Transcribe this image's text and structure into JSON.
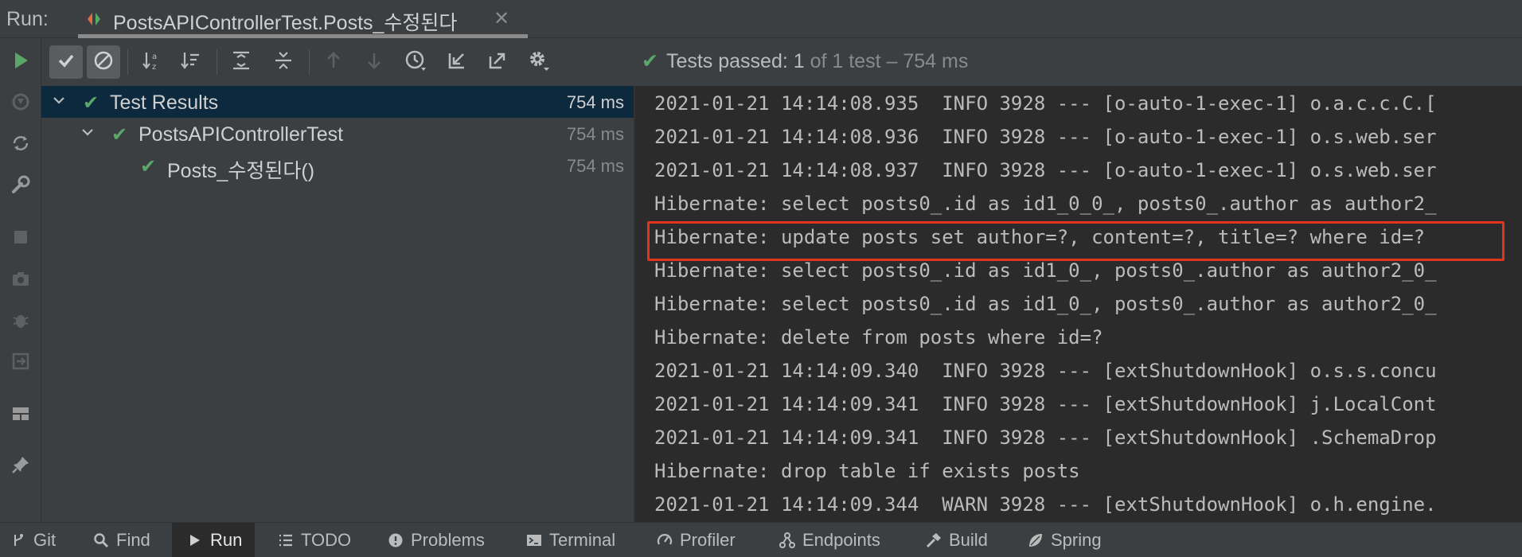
{
  "run_header": {
    "label": "Run:",
    "tab_title": "PostsAPIControllerTest.Posts_수정된다",
    "close_glyph": "✕"
  },
  "status": {
    "check": "✔",
    "passed_label": "Tests passed:",
    "count": "1",
    "rest": "of 1 test – 754 ms"
  },
  "tree": {
    "rows": [
      {
        "name": "Test Results",
        "duration": "754 ms"
      },
      {
        "name": "PostsAPIControllerTest",
        "duration": "754 ms"
      },
      {
        "name": "Posts_수정된다()",
        "duration": "754 ms"
      }
    ],
    "check": "✔"
  },
  "console": {
    "lines": [
      "2021-01-21 14:14:08.935  INFO 3928 --- [o-auto-1-exec-1] o.a.c.c.C.[",
      "2021-01-21 14:14:08.936  INFO 3928 --- [o-auto-1-exec-1] o.s.web.ser",
      "2021-01-21 14:14:08.937  INFO 3928 --- [o-auto-1-exec-1] o.s.web.ser",
      "Hibernate: select posts0_.id as id1_0_0_, posts0_.author as author2_",
      "Hibernate: update posts set author=?, content=?, title=? where id=?",
      "Hibernate: select posts0_.id as id1_0_, posts0_.author as author2_0_",
      "Hibernate: select posts0_.id as id1_0_, posts0_.author as author2_0_",
      "Hibernate: delete from posts where id=?",
      "2021-01-21 14:14:09.340  INFO 3928 --- [extShutdownHook] o.s.s.concu",
      "2021-01-21 14:14:09.341  INFO 3928 --- [extShutdownHook] j.LocalCont",
      "2021-01-21 14:14:09.341  INFO 3928 --- [extShutdownHook] .SchemaDrop",
      "Hibernate: drop table if exists posts",
      "2021-01-21 14:14:09.344  WARN 3928 --- [extShutdownHook] o.h.engine."
    ]
  },
  "bottom_bar": {
    "items": [
      "Git",
      "Find",
      "Run",
      "TODO",
      "Problems",
      "Terminal",
      "Profiler",
      "Endpoints",
      "Build",
      "Spring"
    ]
  },
  "colors": {
    "accent_green": "#59a869",
    "highlight_red": "#e0341d",
    "selection_blue": "#0d293e"
  }
}
